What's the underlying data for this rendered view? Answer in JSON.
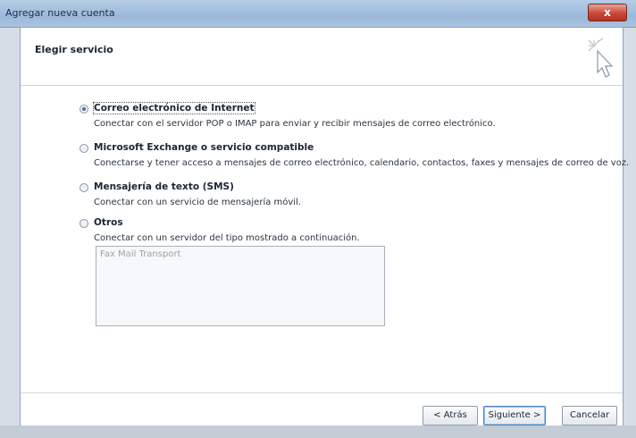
{
  "window": {
    "title": "Agregar nueva cuenta",
    "close_label": "x"
  },
  "header": {
    "title": "Elegir servicio",
    "icon": "wizard-cursor-icon"
  },
  "options": [
    {
      "label": "Correo electrónico de Internet",
      "description": "Conectar con el servidor POP o IMAP para enviar y recibir mensajes de correo electrónico.",
      "selected": true
    },
    {
      "label": "Microsoft Exchange o servicio compatible",
      "description": "Conectarse y tener acceso a mensajes de correo electrónico, calendario, contactos, faxes y mensajes de correo de voz.",
      "selected": false
    },
    {
      "label": "Mensajería de texto (SMS)",
      "description": "Conectar con un servicio de mensajería móvil.",
      "selected": false
    },
    {
      "label": "Otros",
      "description": "Conectar con un servidor del tipo mostrado a continuación.",
      "selected": false
    }
  ],
  "other_services_list": {
    "items": [
      "Fax Mail Transport"
    ]
  },
  "footer": {
    "back_label": "< Atrás",
    "next_label": "Siguiente >",
    "cancel_label": "Cancelar"
  },
  "colors": {
    "titlebar": "#9bb9da",
    "close_button": "#c9483a",
    "accent": "#4b6f9e"
  }
}
